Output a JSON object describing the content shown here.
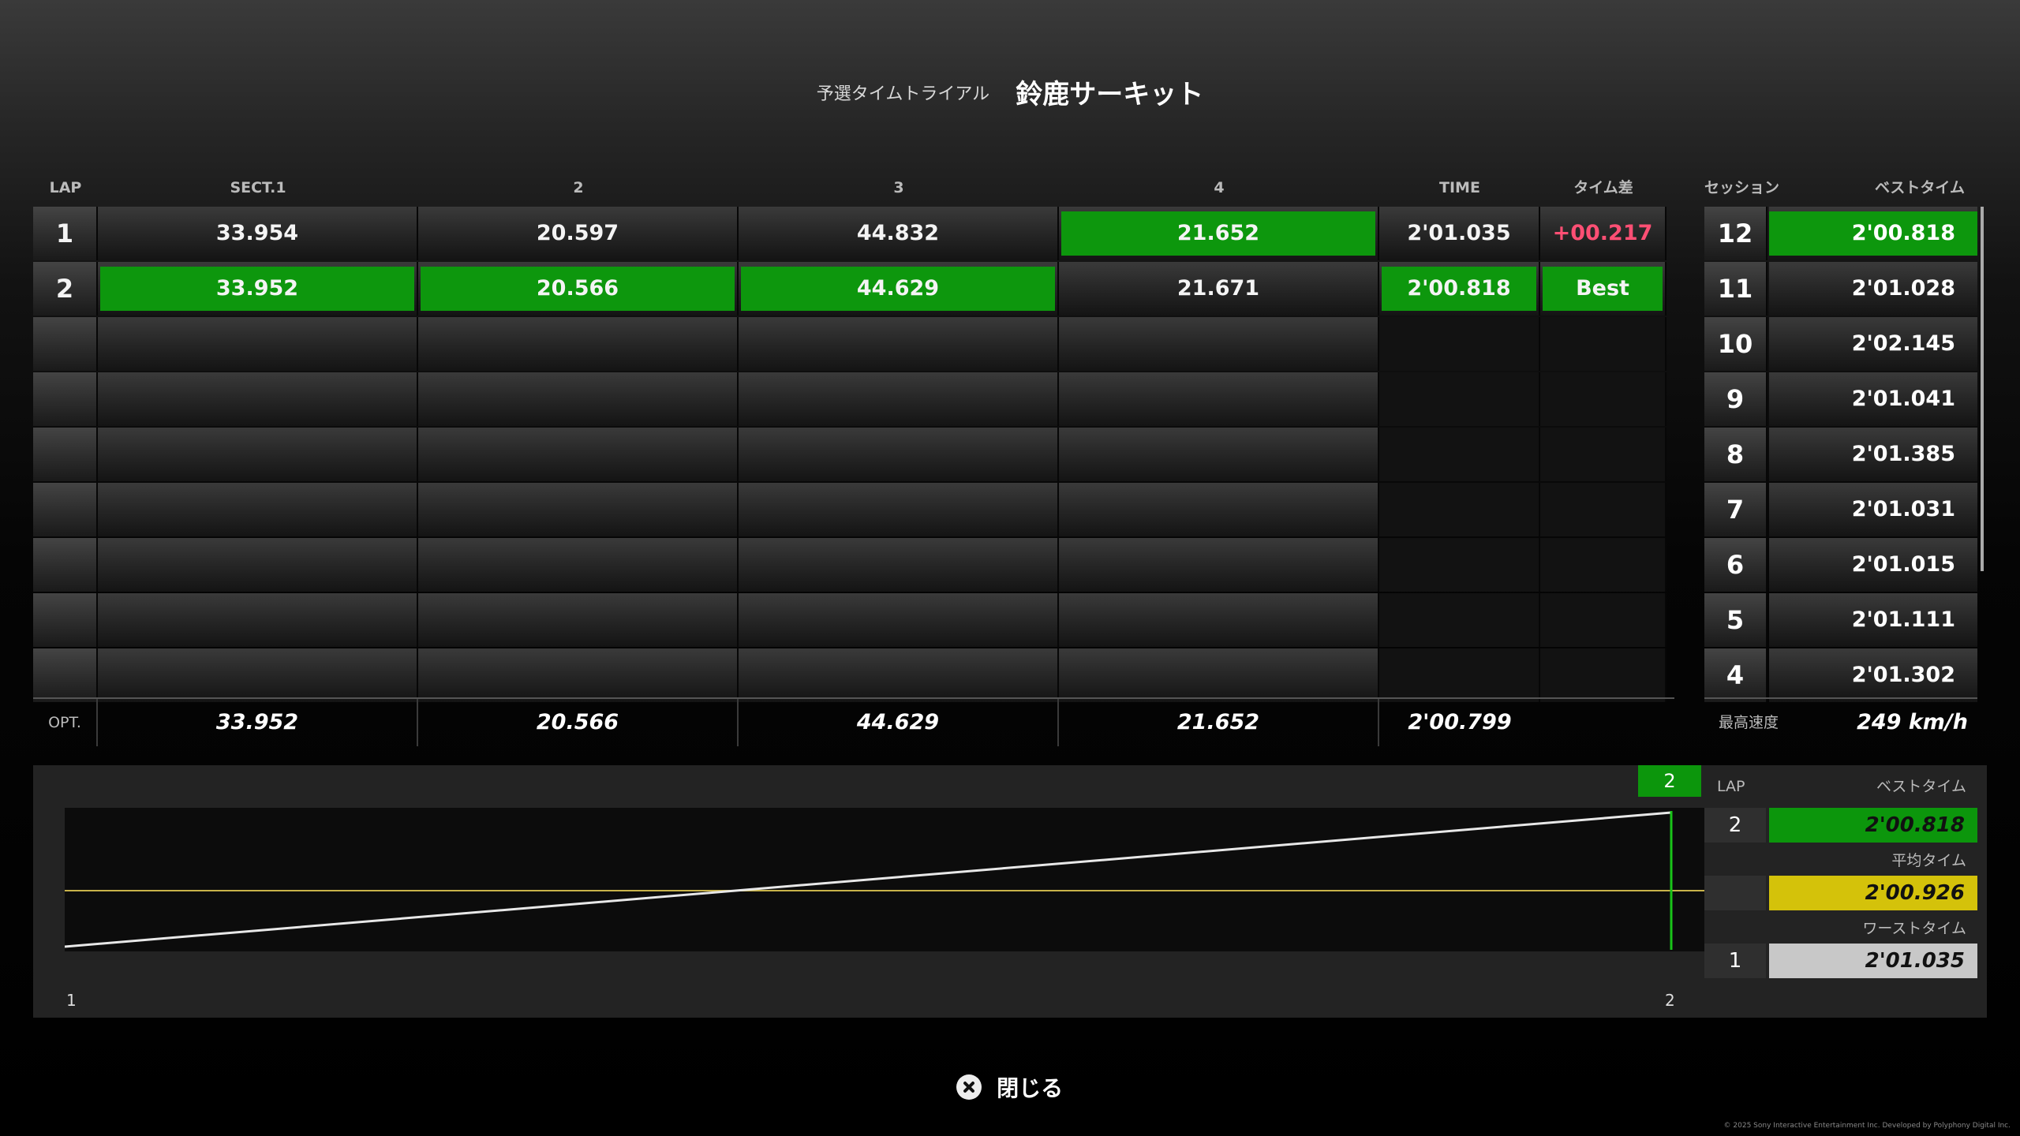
{
  "title": {
    "mode": "予選タイムトライアル",
    "track": "鈴鹿サーキット"
  },
  "headers": {
    "lap": "LAP",
    "s1": "SECT.1",
    "s2": "2",
    "s3": "3",
    "s4": "4",
    "time": "TIME",
    "diff": "タイム差"
  },
  "laps": [
    {
      "lap": "1",
      "s1": "33.954",
      "s2": "20.597",
      "s3": "44.832",
      "s4": "21.652",
      "time": "2'01.035",
      "diff": "+00.217"
    },
    {
      "lap": "2",
      "s1": "33.952",
      "s2": "20.566",
      "s3": "44.629",
      "s4": "21.671",
      "time": "2'00.818",
      "diff": "Best"
    }
  ],
  "optimal": {
    "label": "OPT.",
    "s1": "33.952",
    "s2": "20.566",
    "s3": "44.629",
    "s4": "21.652",
    "time": "2'00.799"
  },
  "session": {
    "header_session": "セッション",
    "header_best": "ベストタイム",
    "rows": [
      {
        "num": "12",
        "time": "2'00.818"
      },
      {
        "num": "11",
        "time": "2'01.028"
      },
      {
        "num": "10",
        "time": "2'02.145"
      },
      {
        "num": "9",
        "time": "2'01.041"
      },
      {
        "num": "8",
        "time": "2'01.385"
      },
      {
        "num": "7",
        "time": "2'01.031"
      },
      {
        "num": "6",
        "time": "2'01.015"
      },
      {
        "num": "5",
        "time": "2'01.111"
      },
      {
        "num": "4",
        "time": "2'01.302"
      }
    ]
  },
  "top_speed": {
    "label": "最高速度",
    "value": "249 km/h"
  },
  "graph": {
    "badge": "2",
    "x_start": "1",
    "x_end": "2"
  },
  "stats": {
    "lap_header": "LAP",
    "best_header": "ベストタイム",
    "best_lap": "2",
    "best_time": "2'00.818",
    "avg_header": "平均タイム",
    "avg_time": "2'00.926",
    "worst_header": "ワーストタイム",
    "worst_lap": "1",
    "worst_time": "2'01.035"
  },
  "close_label": "閉じる",
  "copyright": "© 2025 Sony Interactive Entertainment Inc. Developed by Polyphony Digital Inc.",
  "colors": {
    "green": "#0c960c",
    "yellow": "#d4c20a",
    "gray": "#c8c8c8",
    "negative": "#ff4f74"
  }
}
